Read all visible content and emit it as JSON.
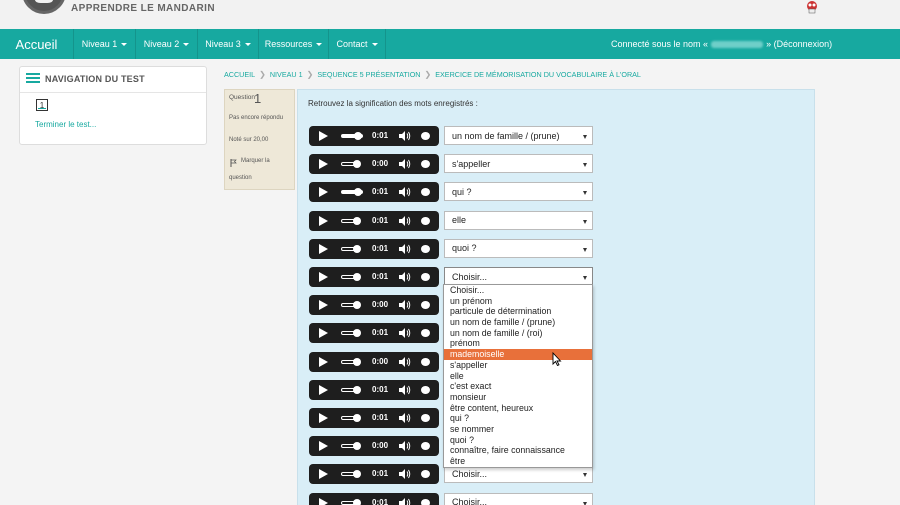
{
  "header": {
    "site_name": "APPRENDRE LE MANDARIN"
  },
  "nav": {
    "home": "Accueil",
    "items": [
      "Niveau 1",
      "Niveau 2",
      "Niveau 3",
      "Ressources",
      "Contact"
    ],
    "user_prefix": "Connecté sous le nom «",
    "user_suffix": "» (Déconnexion)"
  },
  "quiz_nav": {
    "title": "NAVIGATION DU TEST",
    "question_button": "1",
    "finish_link": "Terminer le test..."
  },
  "breadcrumb": [
    "ACCUEIL",
    "NIVEAU 1",
    "SEQUENCE 5 PRÉSENTATION",
    "EXERCICE DE MÉMORISATION DU VOCABULAIRE À L'ORAL"
  ],
  "question_info": {
    "label": "Question",
    "number": "1",
    "state": "Pas encore répondu",
    "grade": "Noté sur 20,00",
    "flag_line1": "Marquer la",
    "flag_line2": "question"
  },
  "question": {
    "prompt": "Retrouvez la signification des mots enregistrés :",
    "rows": [
      {
        "time": "0:01",
        "answer": "un nom de famille / (prune)"
      },
      {
        "time": "0:00",
        "answer": "s'appeller"
      },
      {
        "time": "0:01",
        "answer": "qui ?"
      },
      {
        "time": "0:01",
        "answer": "elle"
      },
      {
        "time": "0:01",
        "answer": "quoi ?"
      },
      {
        "time": "0:01",
        "answer": "Choisir..."
      },
      {
        "time": "0:00",
        "answer": ""
      },
      {
        "time": "0:01",
        "answer": ""
      },
      {
        "time": "0:00",
        "answer": ""
      },
      {
        "time": "0:01",
        "answer": ""
      },
      {
        "time": "0:01",
        "answer": ""
      },
      {
        "time": "0:00",
        "answer": ""
      },
      {
        "time": "0:01",
        "answer": "Choisir..."
      },
      {
        "time": "0:01",
        "answer": "Choisir..."
      }
    ]
  },
  "dropdown": {
    "options": [
      "Choisir...",
      "un prénom",
      "particule de détermination",
      "un nom de famille / (prune)",
      "un nom de famille / (roi)",
      "prénom",
      "mademoiselle",
      "s'appeller",
      "elle",
      "c'est exact",
      "monsieur",
      "être content, heureux",
      "qui ?",
      "se nommer",
      "quoi ?",
      "connaître, faire connaissance",
      "être"
    ],
    "highlighted_index": 6
  },
  "colors": {
    "brand": "#17a9a0",
    "highlight": "#e8703a",
    "question_bg": "#d9eef7"
  }
}
